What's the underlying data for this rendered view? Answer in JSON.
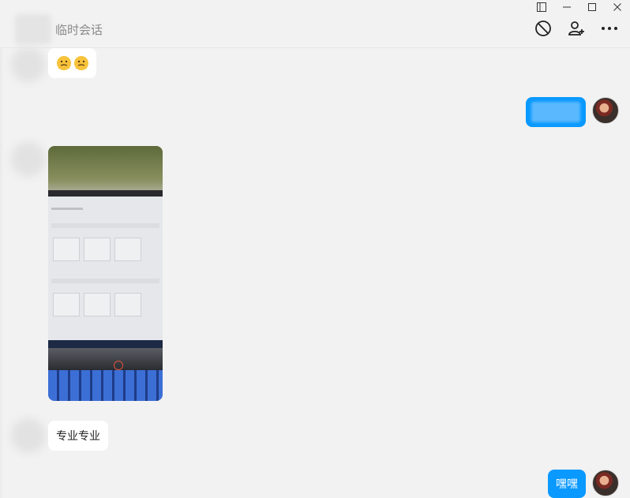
{
  "window": {
    "title": "临时会话",
    "controls": [
      "sidebar-toggle-icon",
      "minimize-icon",
      "maximize-icon",
      "close-icon"
    ]
  },
  "header_actions": [
    {
      "name": "block-icon"
    },
    {
      "name": "add-friend-icon"
    },
    {
      "name": "more-icon"
    }
  ],
  "messages": [
    {
      "direction": "in",
      "type": "emoji",
      "content": "🫠🫠"
    },
    {
      "direction": "out",
      "type": "text-redacted"
    },
    {
      "direction": "in",
      "type": "image"
    },
    {
      "direction": "in",
      "type": "text",
      "content": "专业专业"
    },
    {
      "direction": "out",
      "type": "text",
      "content": "嘿嘿"
    }
  ],
  "colors": {
    "outgoing_bubble": "#0a99ff",
    "incoming_bubble": "#ffffff",
    "background": "#f2f2f2"
  }
}
